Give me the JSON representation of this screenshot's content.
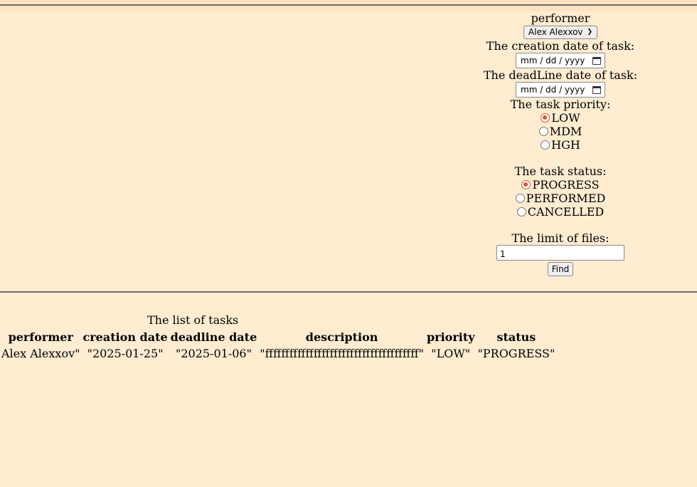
{
  "filters": {
    "performer_label": "performer",
    "performer_selected": "Alex Alexxov",
    "creation_date_label": "The creation date of task:",
    "creation_date_placeholder": "mm / dd / yyyy",
    "deadline_date_label": "The deadLine date of task:",
    "deadline_date_placeholder": "mm / dd / yyyy",
    "priority_label": "The task priority:",
    "priority_options": [
      {
        "label": "LOW",
        "checked": true
      },
      {
        "label": "MDM",
        "checked": false
      },
      {
        "label": "HGH",
        "checked": false
      }
    ],
    "status_label": "The task status:",
    "status_options": [
      {
        "label": "PROGRESS",
        "checked": true
      },
      {
        "label": "PERFORMED",
        "checked": false
      },
      {
        "label": "CANCELLED",
        "checked": false
      }
    ],
    "limit_label": "The limit of files:",
    "limit_value": "1",
    "find_label": "Find"
  },
  "tasks": {
    "caption": "The list of tasks",
    "columns": [
      "performer",
      "creation date",
      "deadline date",
      "description",
      "priority",
      "status"
    ],
    "rows": [
      [
        "Alex Alexxov\"",
        "\"2025-01-25\"",
        "\"2025-01-06\"",
        "\"ffffffffffffffffffffffffffffffffffffff\"",
        "\"LOW\"",
        "\"PROGRESS\""
      ]
    ]
  },
  "colors": {
    "background": "#ffecd1",
    "radio_accent": "#d4552e"
  }
}
